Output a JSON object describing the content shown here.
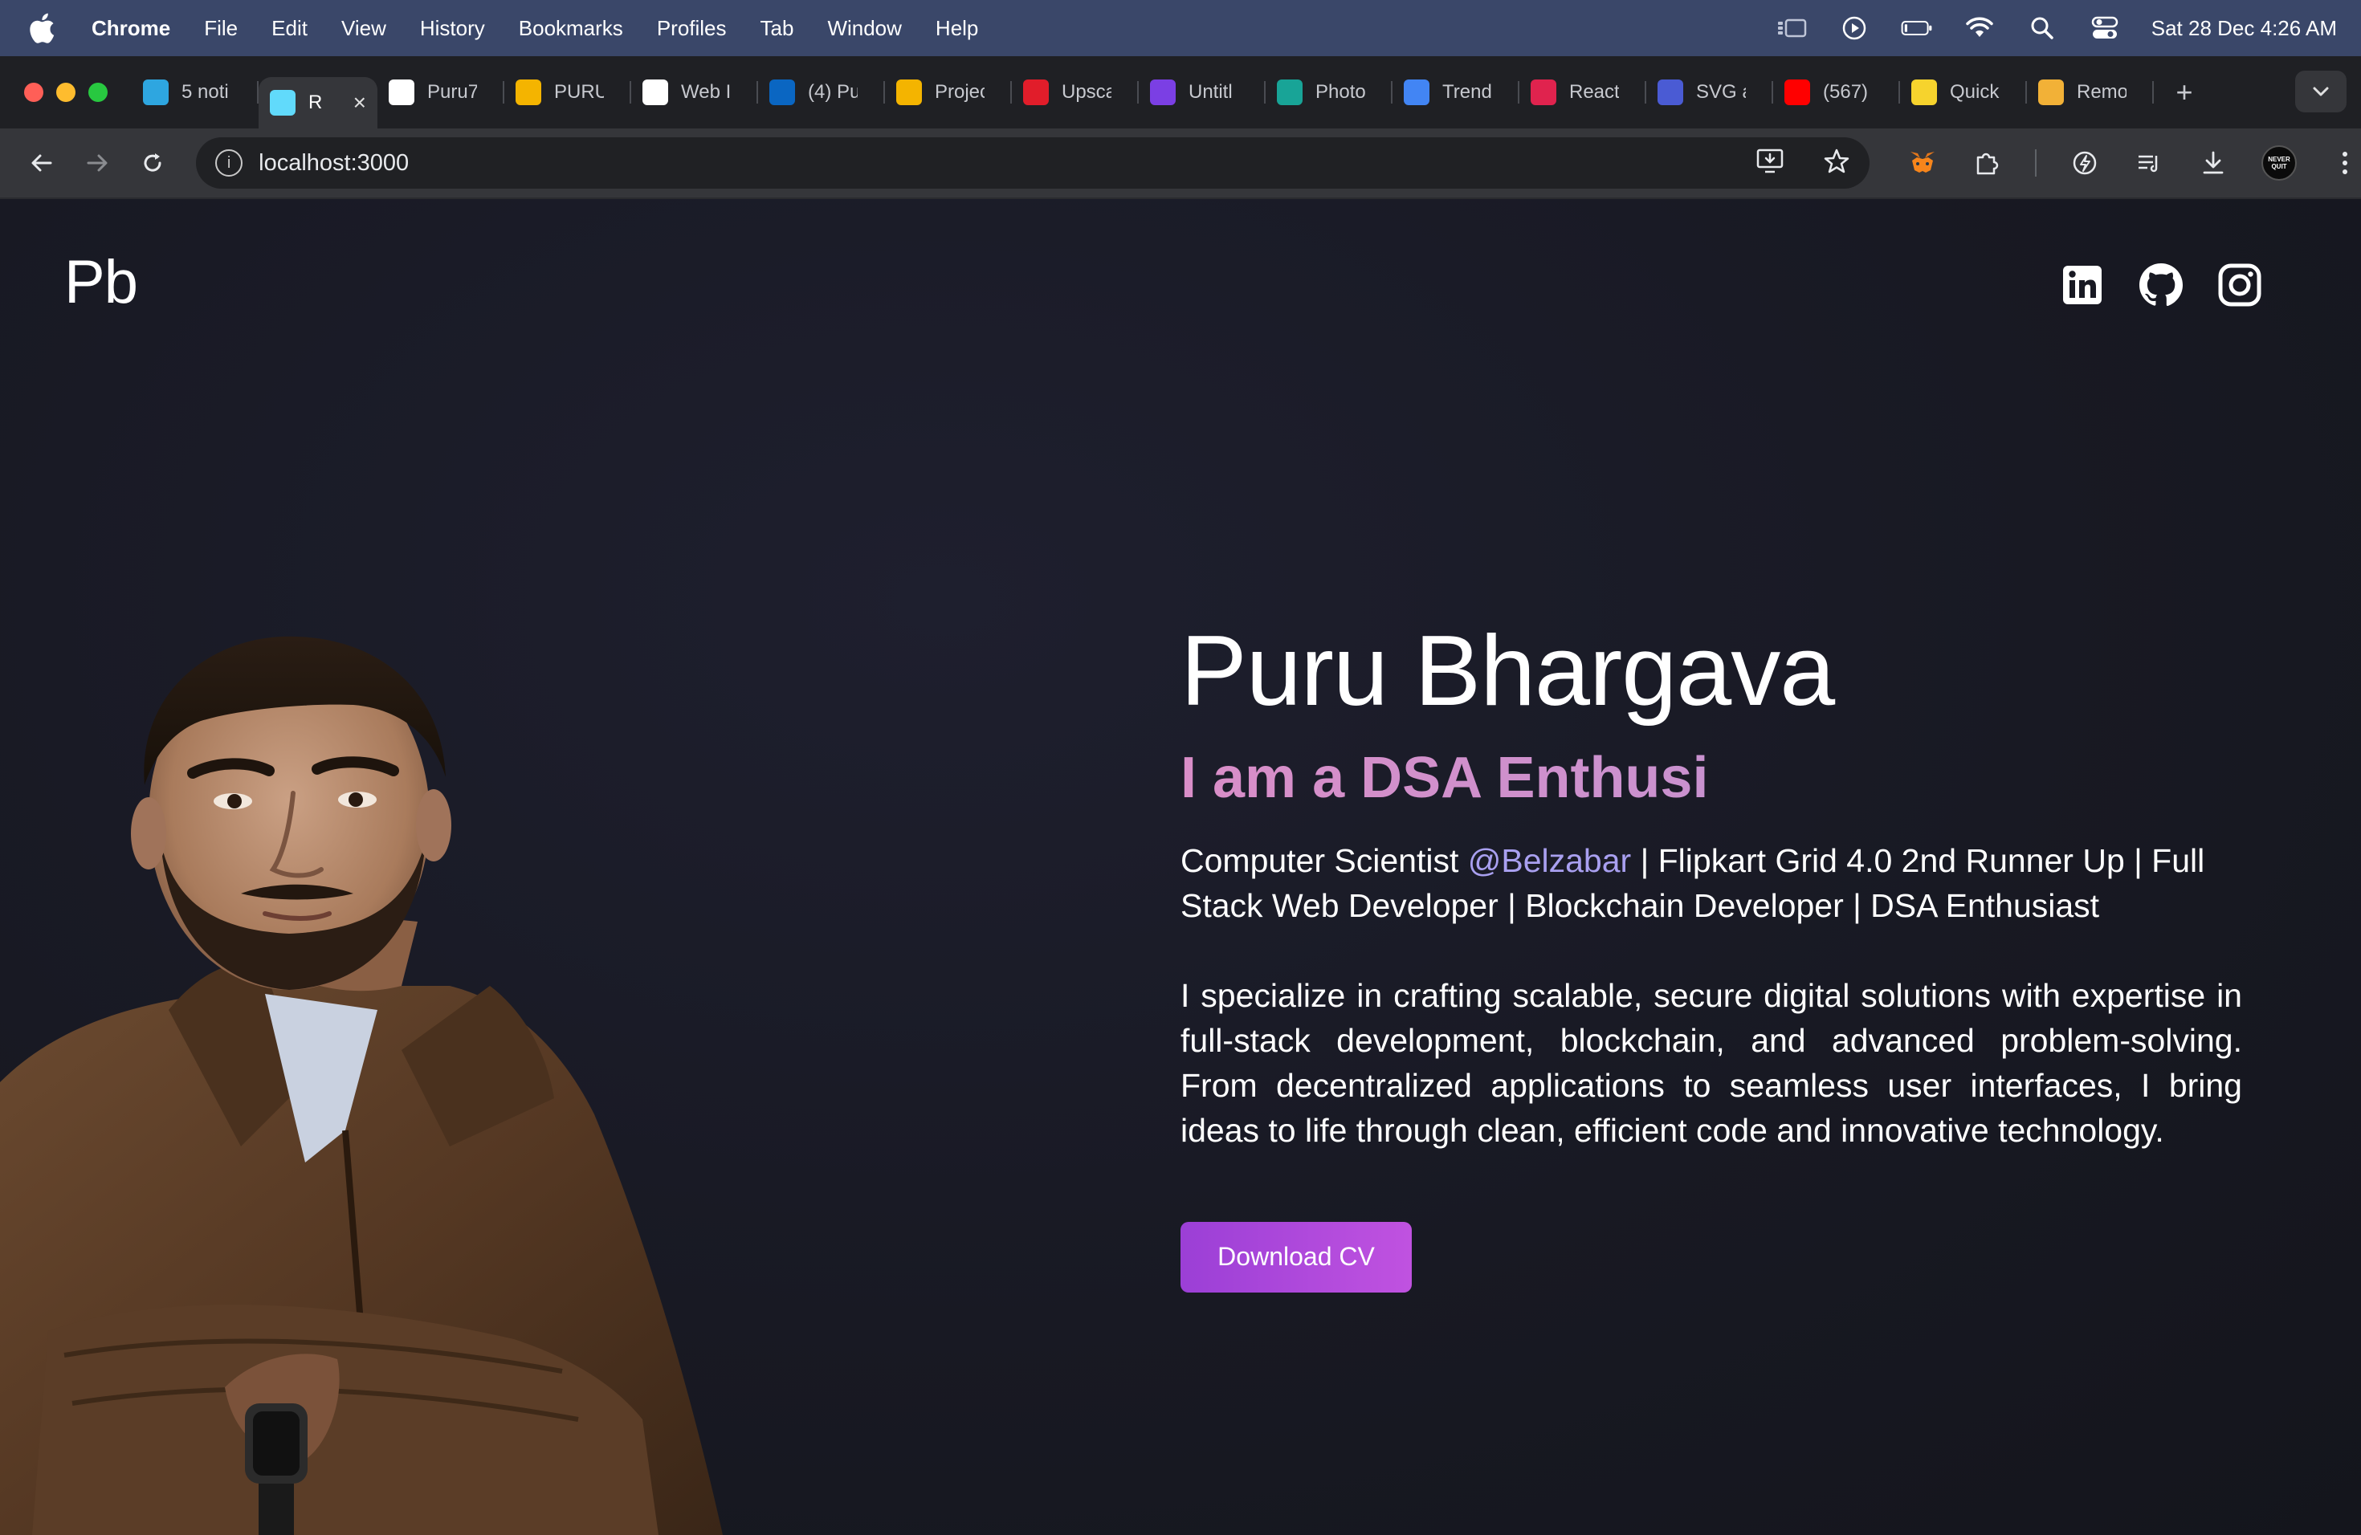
{
  "menubar": {
    "app_name": "Chrome",
    "items": [
      "File",
      "Edit",
      "View",
      "History",
      "Bookmarks",
      "Profiles",
      "Tab",
      "Window",
      "Help"
    ],
    "clock": "Sat 28 Dec  4:26 AM"
  },
  "tabs": [
    {
      "label": "5 noti",
      "icon": "telegram-icon",
      "color": "#2ea6e0"
    },
    {
      "label": "R",
      "icon": "react-icon",
      "color": "#61dafb",
      "active": true
    },
    {
      "label": "Puru7",
      "icon": "github-icon",
      "color": "#ffffff"
    },
    {
      "label": "PURU",
      "icon": "google-drive-icon",
      "color": "#f4b400"
    },
    {
      "label": "Web I",
      "icon": "openai-icon",
      "color": "#ffffff"
    },
    {
      "label": "(4) Pu",
      "icon": "linkedin-icon",
      "color": "#0a66c2"
    },
    {
      "label": "Projec",
      "icon": "google-drive-icon",
      "color": "#f4b400"
    },
    {
      "label": "Upsca",
      "icon": "pixlr-icon",
      "color": "#e11d2a"
    },
    {
      "label": "Untitl",
      "icon": "canva-icon",
      "color": "#7b3fe4"
    },
    {
      "label": "Photo",
      "icon": "photopea-icon",
      "color": "#18a497"
    },
    {
      "label": "Trend",
      "icon": "trend-icon",
      "color": "#4285f4"
    },
    {
      "label": "React",
      "icon": "react-icon",
      "color": "#e0234e"
    },
    {
      "label": "SVG a",
      "icon": "tech-icons-icon",
      "color": "#4a5bd4"
    },
    {
      "label": "(567)",
      "icon": "youtube-icon",
      "color": "#ff0000"
    },
    {
      "label": "Quick",
      "icon": "quickref-icon",
      "color": "#f6d32d"
    },
    {
      "label": "Remo",
      "icon": "remove-bg-icon",
      "color": "#f2b137"
    }
  ],
  "toolbar": {
    "url": "localhost:3000"
  },
  "page": {
    "logo": "Pb",
    "name": "Puru Bhargava",
    "typing": "I am a DSA Enthusi",
    "tagline_before": "Computer Scientist ",
    "tagline_handle": "@Belzabar",
    "tagline_after": " | Flipkart Grid 4.0 2nd Runner Up | Full Stack Web Developer | Blockchain Developer | DSA Enthusiast",
    "bio": "I specialize in crafting scalable, secure digital solutions with expertise in full-stack development, blockchain, and advanced problem-solving. From decentralized applications to seamless user interfaces, I bring ideas to life through clean, efficient code and innovative technology.",
    "cv_button": "Download CV",
    "socials": [
      "linkedin-icon",
      "github-icon",
      "instagram-icon"
    ]
  },
  "colors": {
    "menubar_bg": "#3a4769",
    "page_bg": "#181923",
    "accent_pink": "#d98ec8",
    "handle": "#a9a0f0",
    "button_start": "#9b3fd6",
    "button_end": "#c052e0"
  }
}
